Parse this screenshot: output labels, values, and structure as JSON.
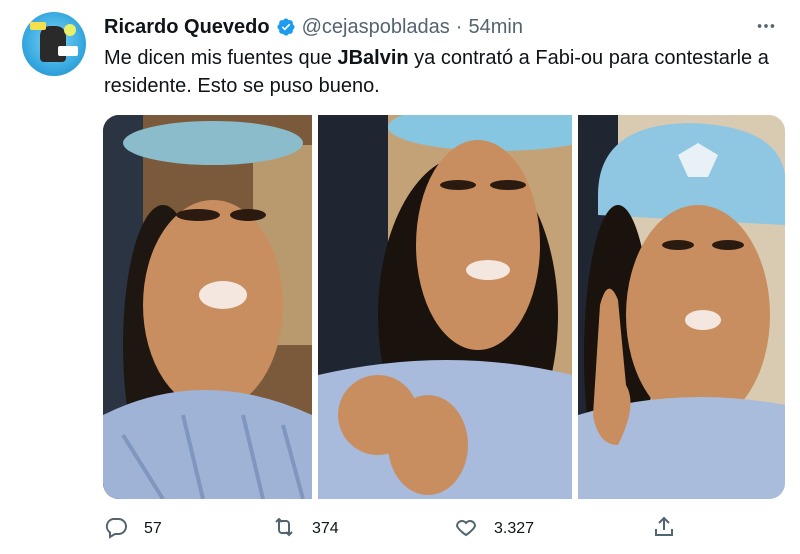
{
  "tweet": {
    "author_name": "Ricardo Quevedo",
    "handle": "@cejaspobladas",
    "separator": "·",
    "time": "54min",
    "text_before": "Me dicen mis fuentes que ",
    "text_bold": "JBalvin",
    "text_after": " ya contrató a Fabi-ou para contestarle a residente. Esto se puso bueno.",
    "media_count": 3
  },
  "actions": {
    "reply_count": "57",
    "retweet_count": "374",
    "like_count": "3.327"
  },
  "colors": {
    "verified": "#1d9bf0",
    "secondary_text": "#536471",
    "primary_text": "#0f1419"
  },
  "icons": [
    "verified-badge-icon",
    "more-icon",
    "reply-icon",
    "retweet-icon",
    "like-icon",
    "share-icon"
  ]
}
